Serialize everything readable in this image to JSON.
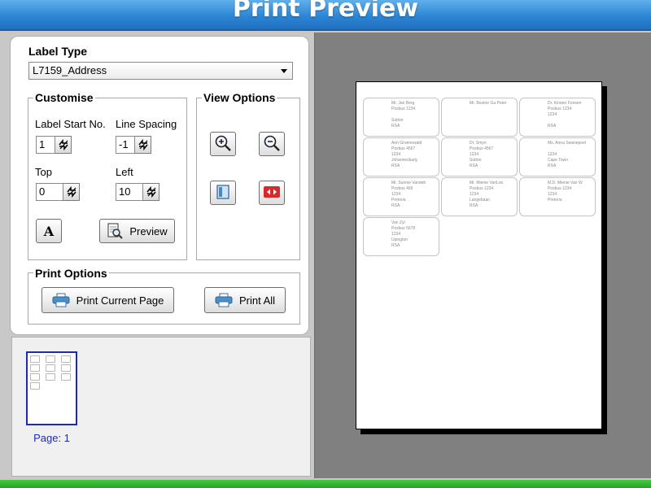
{
  "window": {
    "title": "Print Preview"
  },
  "label_type": {
    "heading": "Label Type",
    "selected": "L7159_Address"
  },
  "customise": {
    "heading": "Customise",
    "label_start": {
      "label": "Label Start No.",
      "value": "1"
    },
    "line_spacing": {
      "label": "Line Spacing",
      "value": "-1"
    },
    "top": {
      "label": "Top",
      "value": "0"
    },
    "left": {
      "label": "Left",
      "value": "10"
    },
    "font_button_label": "A",
    "preview_button_label": "Preview"
  },
  "view_options": {
    "heading": "View Options"
  },
  "print_options": {
    "heading": "Print Options",
    "print_current_label": "Print Current Page",
    "print_all_label": "Print All"
  },
  "thumbnail": {
    "caption": "Page: 1"
  },
  "labels": [
    [
      "Mr. Jan Berg",
      "Posbus 1234",
      "",
      "Sutton",
      "RSA"
    ],
    [
      "Mr. Booker Gu Peter",
      "",
      "",
      "",
      ""
    ],
    [
      "Dr. Kirsten Fonsen",
      "Posbus 1234",
      "1234",
      "",
      "RSA"
    ],
    [
      "Ann Groenewald",
      "Posbus 4567",
      "1234",
      "Johannesburg",
      "RSA"
    ],
    [
      "Dr. Smyn",
      "Posbus 4567",
      "1234",
      "Sutton",
      "RSA"
    ],
    [
      "Ms. Anna Swanepoel",
      "",
      "1234",
      "Cape Town",
      "RSA"
    ],
    [
      "Mr. Sunnie Vandeb",
      "Posbus 465",
      "1234",
      "Pretoria",
      "RSA"
    ],
    [
      "Mr. Mienie VanLoo",
      "Posbus 1234",
      "1234",
      "Langebaan",
      "RSA"
    ],
    [
      "M.D. Mienie Van W",
      "Posbus 1234",
      "1234",
      "Pretoria",
      ""
    ],
    [
      "Van Zyl",
      "Posbus 5678",
      "1234",
      "Upington",
      "RSA"
    ]
  ],
  "colors": {
    "title_bar": "#2d86d4",
    "status_bar": "#1ea61e",
    "preview_background": "#808080",
    "thumbnail_border": "#1f2ca8",
    "fit_icon": "#d62a2a"
  },
  "icons": {
    "zoom_in": "zoom-in-icon",
    "zoom_out": "zoom-out-icon",
    "fit_page": "fit-page-icon",
    "fit_width": "fit-width-icon",
    "font": "font-icon",
    "preview": "magnifier-page-icon",
    "print": "printer-icon",
    "spinner": "spin-arrows-icon"
  }
}
